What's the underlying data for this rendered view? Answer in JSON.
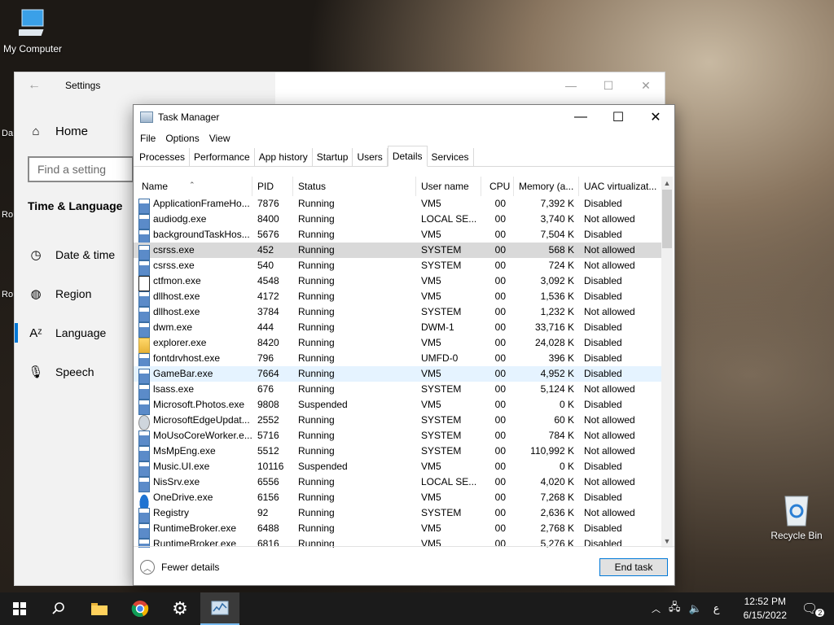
{
  "desktop": {
    "my_computer": "My Computer",
    "recycle_bin": "Recycle Bin",
    "edge_labels": [
      "Da",
      "Ro",
      "Ro"
    ]
  },
  "settings": {
    "title": "Settings",
    "home": "Home",
    "search_placeholder": "Find a setting",
    "section": "Time & Language",
    "nav": [
      "Date & time",
      "Region",
      "Language",
      "Speech"
    ]
  },
  "taskmanager": {
    "title": "Task Manager",
    "menu": [
      "File",
      "Options",
      "View"
    ],
    "tabs": [
      "Processes",
      "Performance",
      "App history",
      "Startup",
      "Users",
      "Details",
      "Services"
    ],
    "active_tab": "Details",
    "columns": [
      "Name",
      "PID",
      "Status",
      "User name",
      "CPU",
      "Memory (a...",
      "UAC virtualizat..."
    ],
    "rows": [
      {
        "name": "ApplicationFrameHo...",
        "pid": "7876",
        "status": "Running",
        "user": "VM5",
        "cpu": "00",
        "mem": "7,392 K",
        "uac": "Disabled",
        "icon": "app"
      },
      {
        "name": "audiodg.exe",
        "pid": "8400",
        "status": "Running",
        "user": "LOCAL SE...",
        "cpu": "00",
        "mem": "3,740 K",
        "uac": "Not allowed",
        "icon": "app"
      },
      {
        "name": "backgroundTaskHos...",
        "pid": "5676",
        "status": "Running",
        "user": "VM5",
        "cpu": "00",
        "mem": "7,504 K",
        "uac": "Disabled",
        "icon": "app"
      },
      {
        "name": "csrss.exe",
        "pid": "452",
        "status": "Running",
        "user": "SYSTEM",
        "cpu": "00",
        "mem": "568 K",
        "uac": "Not allowed",
        "icon": "app"
      },
      {
        "name": "csrss.exe",
        "pid": "540",
        "status": "Running",
        "user": "SYSTEM",
        "cpu": "00",
        "mem": "724 K",
        "uac": "Not allowed",
        "icon": "app"
      },
      {
        "name": "ctfmon.exe",
        "pid": "4548",
        "status": "Running",
        "user": "VM5",
        "cpu": "00",
        "mem": "3,092 K",
        "uac": "Disabled",
        "icon": "pen"
      },
      {
        "name": "dllhost.exe",
        "pid": "4172",
        "status": "Running",
        "user": "VM5",
        "cpu": "00",
        "mem": "1,536 K",
        "uac": "Disabled",
        "icon": "app"
      },
      {
        "name": "dllhost.exe",
        "pid": "3784",
        "status": "Running",
        "user": "SYSTEM",
        "cpu": "00",
        "mem": "1,232 K",
        "uac": "Not allowed",
        "icon": "app"
      },
      {
        "name": "dwm.exe",
        "pid": "444",
        "status": "Running",
        "user": "DWM-1",
        "cpu": "00",
        "mem": "33,716 K",
        "uac": "Disabled",
        "icon": "app"
      },
      {
        "name": "explorer.exe",
        "pid": "8420",
        "status": "Running",
        "user": "VM5",
        "cpu": "00",
        "mem": "24,028 K",
        "uac": "Disabled",
        "icon": "folder"
      },
      {
        "name": "fontdrvhost.exe",
        "pid": "796",
        "status": "Running",
        "user": "UMFD-0",
        "cpu": "00",
        "mem": "396 K",
        "uac": "Disabled",
        "icon": "app"
      },
      {
        "name": "GameBar.exe",
        "pid": "7664",
        "status": "Running",
        "user": "VM5",
        "cpu": "00",
        "mem": "4,952 K",
        "uac": "Disabled",
        "icon": "app"
      },
      {
        "name": "lsass.exe",
        "pid": "676",
        "status": "Running",
        "user": "SYSTEM",
        "cpu": "00",
        "mem": "5,124 K",
        "uac": "Not allowed",
        "icon": "app"
      },
      {
        "name": "Microsoft.Photos.exe",
        "pid": "9808",
        "status": "Suspended",
        "user": "VM5",
        "cpu": "00",
        "mem": "0 K",
        "uac": "Disabled",
        "icon": "app"
      },
      {
        "name": "MicrosoftEdgeUpdat...",
        "pid": "2552",
        "status": "Running",
        "user": "SYSTEM",
        "cpu": "00",
        "mem": "60 K",
        "uac": "Not allowed",
        "icon": "gear"
      },
      {
        "name": "MoUsoCoreWorker.e...",
        "pid": "5716",
        "status": "Running",
        "user": "SYSTEM",
        "cpu": "00",
        "mem": "784 K",
        "uac": "Not allowed",
        "icon": "app"
      },
      {
        "name": "MsMpEng.exe",
        "pid": "5512",
        "status": "Running",
        "user": "SYSTEM",
        "cpu": "00",
        "mem": "110,992 K",
        "uac": "Not allowed",
        "icon": "app"
      },
      {
        "name": "Music.UI.exe",
        "pid": "10116",
        "status": "Suspended",
        "user": "VM5",
        "cpu": "00",
        "mem": "0 K",
        "uac": "Disabled",
        "icon": "app"
      },
      {
        "name": "NisSrv.exe",
        "pid": "6556",
        "status": "Running",
        "user": "LOCAL SE...",
        "cpu": "00",
        "mem": "4,020 K",
        "uac": "Not allowed",
        "icon": "app"
      },
      {
        "name": "OneDrive.exe",
        "pid": "6156",
        "status": "Running",
        "user": "VM5",
        "cpu": "00",
        "mem": "7,268 K",
        "uac": "Disabled",
        "icon": "cloud"
      },
      {
        "name": "Registry",
        "pid": "92",
        "status": "Running",
        "user": "SYSTEM",
        "cpu": "00",
        "mem": "2,636 K",
        "uac": "Not allowed",
        "icon": "app"
      },
      {
        "name": "RuntimeBroker.exe",
        "pid": "6488",
        "status": "Running",
        "user": "VM5",
        "cpu": "00",
        "mem": "2,768 K",
        "uac": "Disabled",
        "icon": "app"
      },
      {
        "name": "RuntimeBroker.exe",
        "pid": "6816",
        "status": "Running",
        "user": "VM5",
        "cpu": "00",
        "mem": "5,276 K",
        "uac": "Disabled",
        "icon": "app"
      }
    ],
    "selected_row": 3,
    "hover_row": 11,
    "fewer_details": "Fewer details",
    "end_task": "End task"
  },
  "taskbar": {
    "ime": "ع",
    "time": "12:52 PM",
    "date": "6/15/2022",
    "notification_count": "2",
    "accent": "#77b9ee"
  }
}
